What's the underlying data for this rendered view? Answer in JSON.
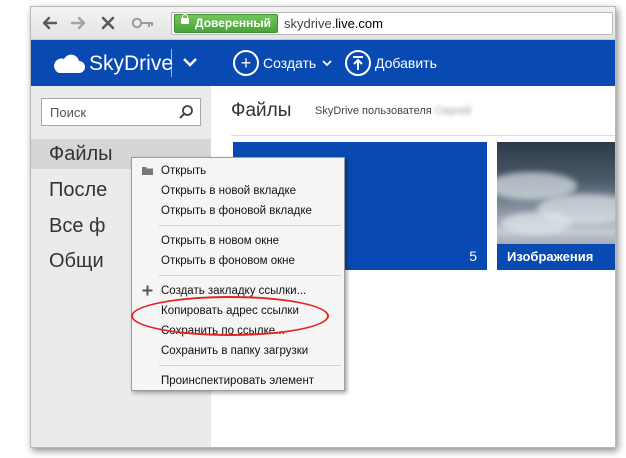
{
  "browser": {
    "back_icon": "arrow-left-icon",
    "forward_icon": "arrow-right-icon",
    "stop_icon": "close-icon",
    "key_icon": "key-icon",
    "security_badge": "Доверенный",
    "url_host": "skydrive.",
    "url_domain": "live.com"
  },
  "appbar": {
    "brand": "SkyDrive",
    "create_label": "Создать",
    "upload_label": "Добавить",
    "color": "#094ab2"
  },
  "sidebar": {
    "search_placeholder": "Поиск",
    "items": [
      {
        "label": "Файлы"
      },
      {
        "label": "После"
      },
      {
        "label": "Все ф"
      },
      {
        "label": "Общи"
      }
    ]
  },
  "main": {
    "title": "Файлы",
    "owner_prefix": "SkyDrive пользователя",
    "owner_name": "Сергей",
    "tiles": [
      {
        "count": "5"
      },
      {
        "label": "Изображения"
      }
    ]
  },
  "context_menu": {
    "items": [
      {
        "label": "Открыть"
      },
      {
        "label": "Открыть в новой вкладке"
      },
      {
        "label": "Открыть в фоновой вкладке"
      },
      {
        "label": "Открыть в новом окне"
      },
      {
        "label": "Открыть в фоновом окне"
      },
      {
        "label": "Создать закладку ссылки..."
      },
      {
        "label": "Копировать адрес ссылки"
      },
      {
        "label": "Сохранить по ссылке..."
      },
      {
        "label": "Сохранить в папку загрузки"
      },
      {
        "label": "Проинспектировать элемент"
      }
    ],
    "highlight_color": "#e32626"
  }
}
